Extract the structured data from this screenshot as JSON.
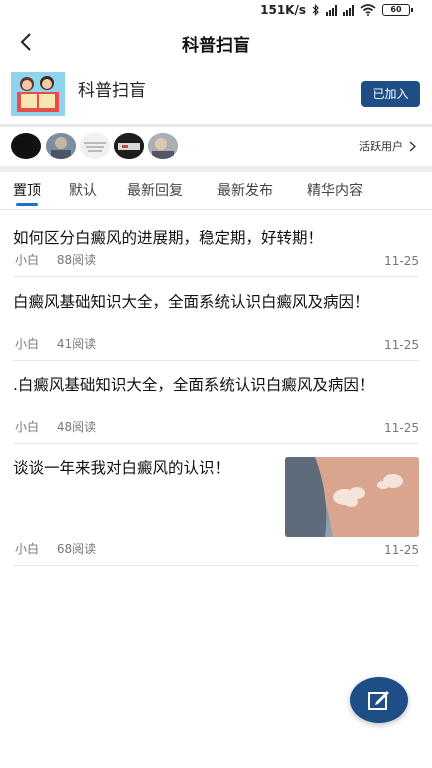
{
  "status": {
    "network_speed": "151K/s",
    "battery": "60"
  },
  "header": {
    "title": "科普扫盲"
  },
  "group": {
    "name": "科普扫盲",
    "join_status": "已加入"
  },
  "users": {
    "active_label": "活跃用户"
  },
  "tabs": [
    {
      "label": "置顶"
    },
    {
      "label": "默认"
    },
    {
      "label": "最新回复"
    },
    {
      "label": "最新发布"
    },
    {
      "label": "精华内容"
    }
  ],
  "posts": [
    {
      "title": "如何区分白癜风的进展期，稳定期，好转期！",
      "author": "小白",
      "reads": "88阅读",
      "date": "11-25"
    },
    {
      "title": "白癜风基础知识大全，全面系统认识白癜风及病因！",
      "author": "小白",
      "reads": "41阅读",
      "date": "11-25"
    },
    {
      "title": ".白癜风基础知识大全，全面系统认识白癜风及病因！",
      "author": "小白",
      "reads": "48阅读",
      "date": "11-25"
    },
    {
      "title": "谈谈一年来我对白癜风的认识！",
      "author": "小白",
      "reads": "68阅读",
      "date": "11-25"
    }
  ],
  "colors": {
    "accent": "#1f4e86",
    "tab_indicator": "#1f6fd1"
  }
}
